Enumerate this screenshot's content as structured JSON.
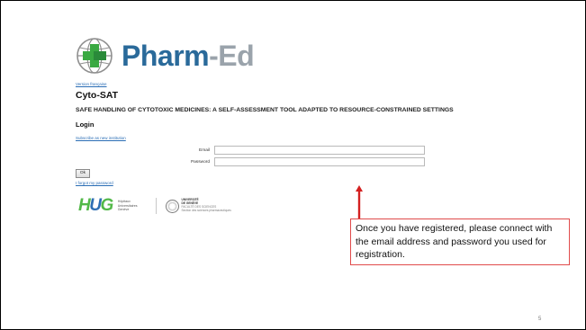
{
  "logo": {
    "brand_main": "Pharm",
    "brand_accent": "-Ed",
    "brand_color": "#2a6a9a",
    "accent_color": "#9aa3ab",
    "cross_color": "#3aa942",
    "icon": "globe-cross-icon"
  },
  "header": {
    "version_link": "Version française",
    "app_title": "Cyto-SAT",
    "subtitle": "SAFE HANDLING OF CYTOTOXIC MEDICINES: A SELF-ASSESSMENT TOOL ADAPTED TO RESOURCE-CONSTRAINED SETTINGS"
  },
  "login": {
    "heading": "Login",
    "subscribe_link": "Subscribe as new institution",
    "email_label": "Email",
    "email_value": "",
    "password_label": "Password",
    "password_value": "",
    "ok_label": "Ok",
    "forgot_link": "I forgot my password"
  },
  "partners": {
    "hug_h": "H",
    "hug_u": "U",
    "hug_g": "G",
    "hug_line1": "Hôpitaux",
    "hug_line2": "Universitaires",
    "hug_line3": "Genève",
    "unige_line1": "UNIVERSITÉ",
    "unige_line2": "DE GENÈVE",
    "unige_line3": "FACULTÉ DES SCIENCES",
    "unige_line4": "Section des sciences pharmaceutiques"
  },
  "annotation": {
    "text": "Once you have registered, please connect with the email address and password you used for registration.",
    "color": "#e04b4b"
  },
  "slide": {
    "page_number": "5"
  }
}
